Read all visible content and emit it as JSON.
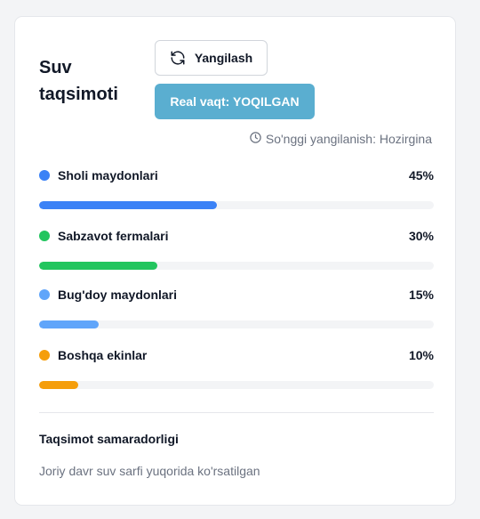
{
  "card": {
    "title_line1": "Suv",
    "title_line2": "taqsimoti",
    "refresh_label": "Yangilash",
    "realtime_label": "Real vaqt: YOQILGAN",
    "last_updated": "So'nggi yangilanish: Hozirgina"
  },
  "distribution": [
    {
      "label": "Sholi maydonlari",
      "percent_text": "45%",
      "value": 45,
      "color": "#3b82f6"
    },
    {
      "label": "Sabzavot fermalari",
      "percent_text": "30%",
      "value": 30,
      "color": "#22c55e"
    },
    {
      "label": "Bug'doy maydonlari",
      "percent_text": "15%",
      "value": 15,
      "color": "#60a5fa"
    },
    {
      "label": "Boshqa ekinlar",
      "percent_text": "10%",
      "value": 10,
      "color": "#f59e0b"
    }
  ],
  "efficiency": {
    "title": "Taqsimot samaradorligi",
    "text": "Joriy davr suv sarfi yuqorida ko'rsatilgan"
  },
  "colors": {
    "accent": "#5aaed0",
    "track": "#f3f4f6"
  },
  "icons": {
    "refresh": "refresh-icon",
    "clock": "clock-icon"
  }
}
